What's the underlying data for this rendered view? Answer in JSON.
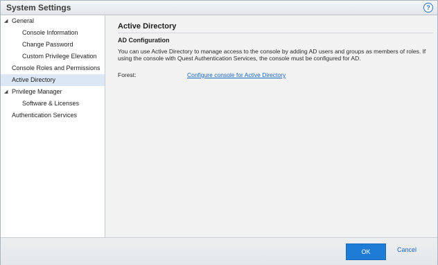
{
  "window": {
    "title": "System Settings",
    "help_glyph": "?"
  },
  "sidebar": {
    "items": [
      {
        "label": "General",
        "expander": "◢"
      },
      {
        "label": "Console Information"
      },
      {
        "label": "Change Password"
      },
      {
        "label": "Custom Privilege Elevation"
      },
      {
        "label": "Console Roles and Permissions"
      },
      {
        "label": "Active Directory",
        "selected": true
      },
      {
        "label": "Privilege Manager",
        "expander": "◢"
      },
      {
        "label": "Software & Licenses"
      },
      {
        "label": "Authentication Services"
      }
    ]
  },
  "main": {
    "section_title": "Active Directory",
    "subheading": "AD Configuration",
    "description": "You can use Active Directory to manage access to the console by adding AD users and groups as members of roles. If using the console with Quest Authentication Services, the console must be configured for AD.",
    "forest_label": "Forest:",
    "forest_link": "Configure console for Active Directory"
  },
  "footer": {
    "ok_label": "OK",
    "cancel_label": "Cancel"
  },
  "colors": {
    "accent": "#1e7bd6",
    "link": "#1a66c8",
    "selection": "#dbe7f5"
  }
}
